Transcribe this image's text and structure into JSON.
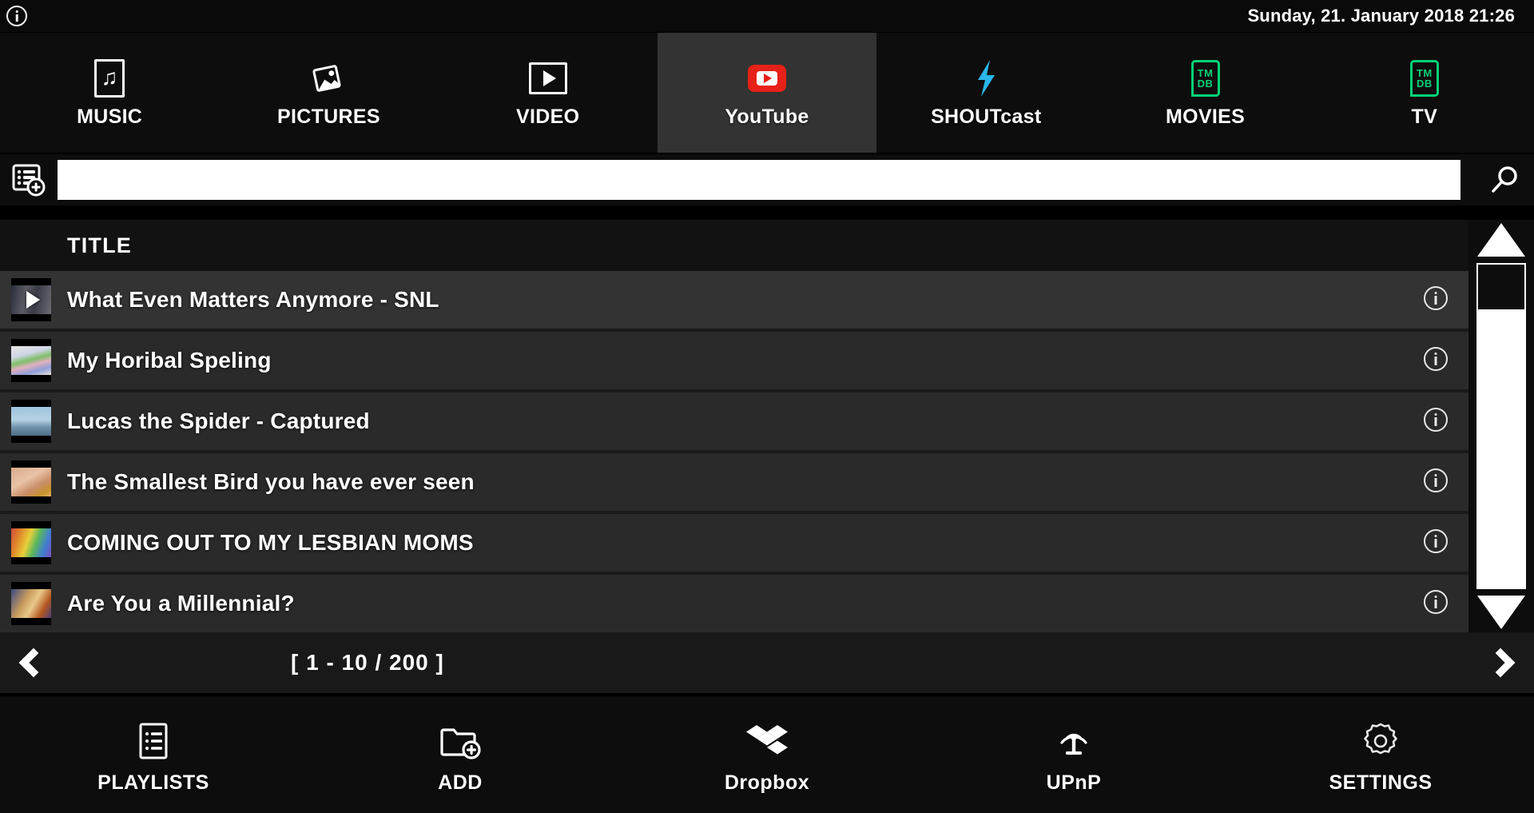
{
  "statusbar": {
    "info_icon": "info-icon",
    "clock": "Sunday, 21. January 2018 21:26"
  },
  "tabs": [
    {
      "label": "MUSIC",
      "icon": "music-note-icon",
      "active": false
    },
    {
      "label": "PICTURES",
      "icon": "photos-icon",
      "active": false
    },
    {
      "label": "VIDEO",
      "icon": "video-play-icon",
      "active": false
    },
    {
      "label": "YouTube",
      "icon": "youtube-icon",
      "active": true
    },
    {
      "label": "SHOUTcast",
      "icon": "lightning-icon",
      "active": false
    },
    {
      "label": "MOVIES",
      "icon": "tmdb-icon",
      "active": false
    },
    {
      "label": "TV",
      "icon": "tmdb-icon",
      "active": false
    }
  ],
  "search": {
    "playlist_add_icon": "playlist-add-icon",
    "value": "",
    "placeholder": "",
    "search_icon": "search-icon"
  },
  "list": {
    "column_header": "TITLE",
    "rows": [
      {
        "title": "What Even Matters Anymore - SNL",
        "selected": true,
        "playing": true,
        "info_icon": "info-icon"
      },
      {
        "title": "My Horibal Speling",
        "selected": false,
        "playing": false,
        "info_icon": "info-icon"
      },
      {
        "title": "Lucas the Spider - Captured",
        "selected": false,
        "playing": false,
        "info_icon": "info-icon"
      },
      {
        "title": "The Smallest Bird you have ever seen",
        "selected": false,
        "playing": false,
        "info_icon": "info-icon"
      },
      {
        "title": "COMING OUT TO MY LESBIAN MOMS",
        "selected": false,
        "playing": false,
        "info_icon": "info-icon"
      },
      {
        "title": "Are You a Millennial?",
        "selected": false,
        "playing": false,
        "info_icon": "info-icon"
      }
    ]
  },
  "scrollbar": {
    "up_icon": "scroll-up-arrow-icon",
    "down_icon": "scroll-down-arrow-icon",
    "thumb_position_percent": 0
  },
  "pagination": {
    "prev_icon": "chevron-left-icon",
    "next_icon": "chevron-right-icon",
    "range_label": "[ 1 - 10 / 200 ]"
  },
  "bottombar": [
    {
      "label": "PLAYLISTS",
      "icon": "playlist-document-icon"
    },
    {
      "label": "ADD",
      "icon": "folder-add-icon"
    },
    {
      "label": "Dropbox",
      "icon": "dropbox-icon"
    },
    {
      "label": "UPnP",
      "icon": "broadcast-antenna-icon"
    },
    {
      "label": "SETTINGS",
      "icon": "gear-icon"
    }
  ],
  "colors": {
    "background": "#000000",
    "panel": "#0d0d0d",
    "row": "#2a2a2a",
    "row_selected": "#333333",
    "accent_youtube": "#e62117",
    "accent_shoutcast": "#29b6e8",
    "accent_tmdb": "#01d277",
    "text": "#ffffff"
  }
}
